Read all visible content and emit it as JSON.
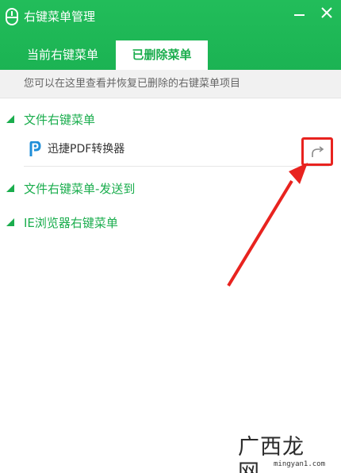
{
  "window": {
    "title": "右键菜单管理",
    "accent_color": "#1aad4d"
  },
  "tabs": [
    {
      "label": "当前右键菜单",
      "active": false
    },
    {
      "label": "已删除菜单",
      "active": true
    }
  ],
  "info": {
    "text": "您可以在这里查看并恢复已删除的右键菜单项目"
  },
  "categories": [
    {
      "label": "文件右键菜单",
      "expanded": true,
      "items": [
        {
          "name": "迅捷PDF转换器",
          "icon": "pdf-converter-icon",
          "action_icon": "restore-icon"
        }
      ]
    },
    {
      "label": "文件右键菜单-发送到",
      "expanded": false,
      "items": []
    },
    {
      "label": "IE浏览器右键菜单",
      "expanded": false,
      "items": []
    }
  ],
  "annotation": {
    "highlight_color": "#e8231f"
  },
  "watermark": {
    "text": "广西龙网",
    "url": "mingyan1.com"
  }
}
